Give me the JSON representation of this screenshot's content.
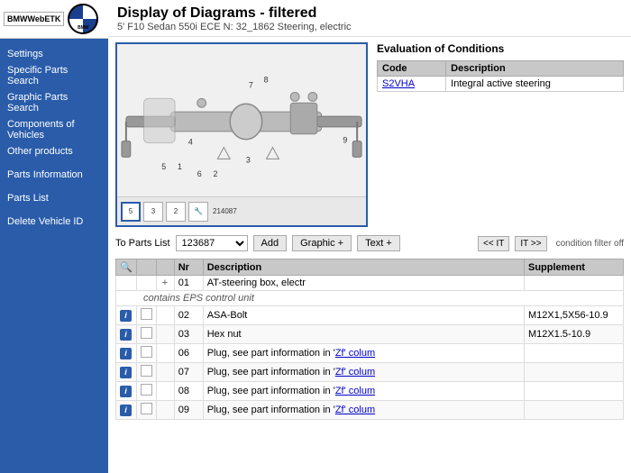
{
  "sidebar": {
    "logo_etk": "BMWWebETK",
    "items": [
      {
        "id": "settings",
        "label": "Settings"
      },
      {
        "id": "specific-parts-search",
        "label": "Specific Parts Search"
      },
      {
        "id": "graphic-parts-search",
        "label": "Graphic Parts Search"
      },
      {
        "id": "components-of-vehicles",
        "label": "Components of Vehicles"
      },
      {
        "id": "other-products",
        "label": "Other products"
      },
      {
        "id": "parts-information",
        "label": "Parts Information"
      },
      {
        "id": "parts-list",
        "label": "Parts List"
      },
      {
        "id": "delete-vehicle-id",
        "label": "Delete Vehicle ID"
      }
    ]
  },
  "header": {
    "title": "Display of Diagrams - filtered",
    "subtitle": "5' F10 Sedan 550i ECE N: 32_1862 Steering, electric"
  },
  "evaluation": {
    "title": "Evaluation of Conditions",
    "columns": [
      "Code",
      "Description"
    ],
    "rows": [
      {
        "code": "S2VHA",
        "description": "Integral active steering"
      }
    ]
  },
  "toolbar": {
    "to_parts_list_label": "To Parts List",
    "parts_list_value": "123687",
    "add_button": "Add",
    "graphic_button": "Graphic +",
    "text_button": "Text +",
    "prev_button": "<< IT",
    "next_button": "IT >>",
    "filter_label": "condition filter off"
  },
  "parts_table": {
    "columns": [
      "",
      "",
      "",
      "Nr",
      "Description",
      "Supplement"
    ],
    "search_icon": "🔍",
    "rows": [
      {
        "type": "header",
        "icon_i": false,
        "icon_check": false,
        "icon_plus": "+",
        "nr": "01",
        "description": "AT-steering box, electr",
        "supplement": "",
        "sub": "contains EPS control unit"
      },
      {
        "type": "row",
        "icon_i": true,
        "icon_check": true,
        "nr": "02",
        "description": "ASA-Bolt",
        "supplement": "M12X1,5X56-10.9"
      },
      {
        "type": "row",
        "icon_i": true,
        "icon_check": true,
        "nr": "03",
        "description": "Hex nut",
        "supplement": "M12X1.5-10.9"
      },
      {
        "type": "row",
        "icon_i": true,
        "icon_check": true,
        "nr": "06",
        "description": "Plug, see part information in 'Zf' colum",
        "supplement": ""
      },
      {
        "type": "row",
        "icon_i": true,
        "icon_check": true,
        "nr": "07",
        "description": "Plug, see part information in 'Zf' colum",
        "supplement": ""
      },
      {
        "type": "row",
        "icon_i": true,
        "icon_check": true,
        "nr": "08",
        "description": "Plug, see part information in 'Zf' colum",
        "supplement": ""
      },
      {
        "type": "row",
        "icon_i": true,
        "icon_check": true,
        "nr": "09",
        "description": "Plug, see part information in 'Zf' colum",
        "supplement": ""
      }
    ]
  },
  "diagram": {
    "thumbnails": [
      "5",
      "3",
      "2",
      "🔧"
    ],
    "diagram_number": "214087"
  }
}
